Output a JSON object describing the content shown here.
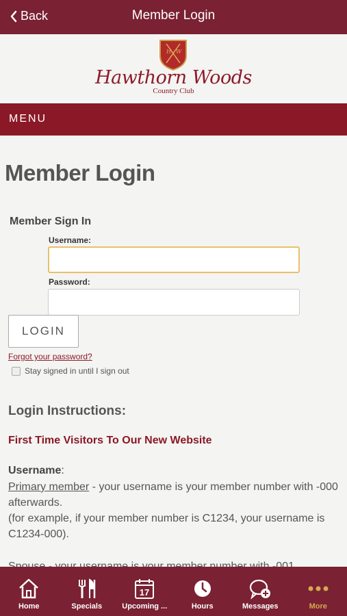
{
  "navbar": {
    "back_label": "Back",
    "title": "Member Login"
  },
  "logo": {
    "name": "Hawthorn Woods",
    "subtitle": "Country Club",
    "monogram": "H W"
  },
  "menu": {
    "label": "MENU"
  },
  "page": {
    "title": "Member Login",
    "signin_title": "Member Sign In",
    "username_label": "Username:",
    "username_value": "",
    "password_label": "Password:",
    "password_value": "",
    "login_button": "LOGIN",
    "forgot_link": "Forgot your password?",
    "stay_signed_in": "Stay signed in until I sign out",
    "instructions_title": "Login Instructions:",
    "first_time": "First Time Visitors To Our New Website",
    "username_heading": "Username",
    "username_colon": ":",
    "primary_member": "Primary member",
    "primary_text": " - your username is your member number with -000 afterwards.",
    "example_text": "(for example, if your member number is C1234, your username is C1234-000).",
    "spouse_text": "Spouse - your username is your member number with -001"
  },
  "tabbar": {
    "items": [
      {
        "label": "Home",
        "icon": "home-icon"
      },
      {
        "label": "Specials",
        "icon": "cutlery-icon"
      },
      {
        "label": "Upcoming ...",
        "icon": "calendar-icon",
        "badge": "17"
      },
      {
        "label": "Hours",
        "icon": "clock-icon"
      },
      {
        "label": "Messages",
        "icon": "messages-icon"
      },
      {
        "label": "More",
        "icon": "more-icon"
      }
    ],
    "active_color": "#d4a94f"
  },
  "colors": {
    "navbar": "#7a2133",
    "menu_bar": "#8a1826",
    "accent": "#8a1826"
  }
}
